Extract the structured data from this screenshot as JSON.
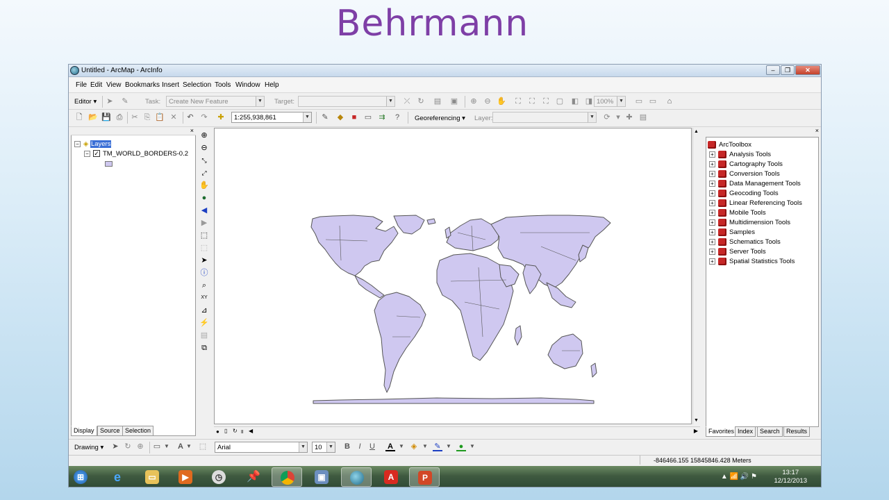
{
  "slide": {
    "title": "Behrmann"
  },
  "window": {
    "title": "Untitled - ArcMap - ArcInfo"
  },
  "menu": [
    "File",
    "Edit",
    "View",
    "Bookmarks",
    "Insert",
    "Selection",
    "Tools",
    "Window",
    "Help"
  ],
  "editor_toolbar": {
    "editor_label": "Editor",
    "task_label": "Task:",
    "task_value": "Create New Feature",
    "target_label": "Target:",
    "zoom_value": "100%"
  },
  "standard_toolbar": {
    "scale_value": "1:255,938,861",
    "georef_label": "Georeferencing",
    "layer_label": "Layer:"
  },
  "toc": {
    "root_label": "Layers",
    "layer_name": "TM_WORLD_BORDERS-0.2",
    "tabs": [
      "Display",
      "Source",
      "Selection"
    ]
  },
  "arctoolbox": {
    "root_label": "ArcToolbox",
    "tools": [
      "Analysis Tools",
      "Cartography Tools",
      "Conversion Tools",
      "Data Management Tools",
      "Geocoding Tools",
      "Linear Referencing Tools",
      "Mobile Tools",
      "Multidimension Tools",
      "Samples",
      "Schematics Tools",
      "Server Tools",
      "Spatial Statistics Tools"
    ],
    "tabs": [
      "Favorites",
      "Index",
      "Search",
      "Results"
    ]
  },
  "drawing_toolbar": {
    "drawing_label": "Drawing",
    "font_value": "Arial",
    "size_value": "10",
    "bold": "B",
    "italic": "I",
    "underline": "U"
  },
  "status": {
    "coordinates": "-846466.155  15845846.428 Meters"
  },
  "taskbar": {
    "time": "13:17",
    "date": "12/12/2013"
  },
  "colors": {
    "land_fill": "#cfc8f0",
    "land_stroke": "#555555",
    "title_color": "#7e3fa6"
  }
}
